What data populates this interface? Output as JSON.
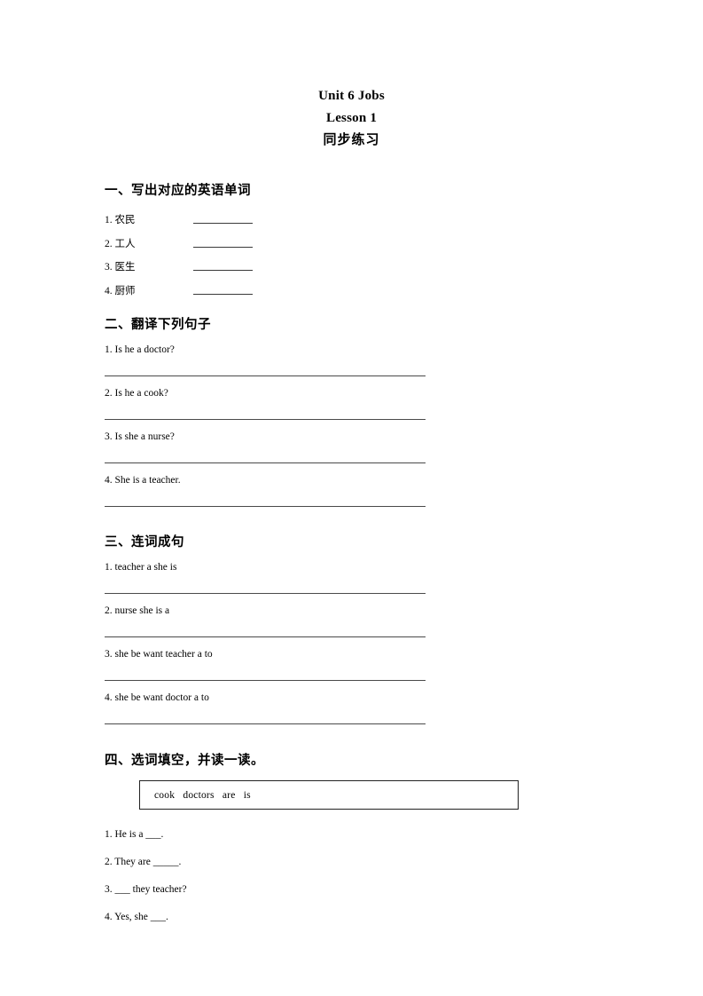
{
  "document": {
    "title_lines": [
      "Unit 6 Jobs",
      "Lesson 1",
      "同步练习"
    ]
  },
  "sections": [
    {
      "heading": "一、写出对应的英语单词",
      "items": [
        {
          "number": "1.",
          "text": "农民"
        },
        {
          "number": "2.",
          "text": "工人"
        },
        {
          "number": "3.",
          "text": "医生"
        },
        {
          "number": "4.",
          "text": "厨师"
        }
      ]
    },
    {
      "heading": "二、翻译下列句子",
      "items": [
        {
          "text": "1. Is he a doctor?"
        },
        {
          "text": "2. Is he a cook?"
        },
        {
          "text": "3. Is she a nurse?"
        },
        {
          "text": "4. She is a teacher."
        }
      ]
    },
    {
      "heading": "三、连词成句",
      "items": [
        {
          "text": "1. teacher a she is"
        },
        {
          "text": "2. nurse she is a"
        },
        {
          "text": "3. she be want teacher a to"
        },
        {
          "text": "4. she be want doctor a to"
        }
      ]
    },
    {
      "heading": "四、选词填空，并读一读。",
      "wordbank": "cook   doctors   are   is",
      "items": [
        {
          "text": "1. He is a ___."
        },
        {
          "text": "2. They are _____."
        },
        {
          "text": "3. ___ they teacher?"
        },
        {
          "text": "4. Yes, she ___."
        }
      ]
    }
  ]
}
